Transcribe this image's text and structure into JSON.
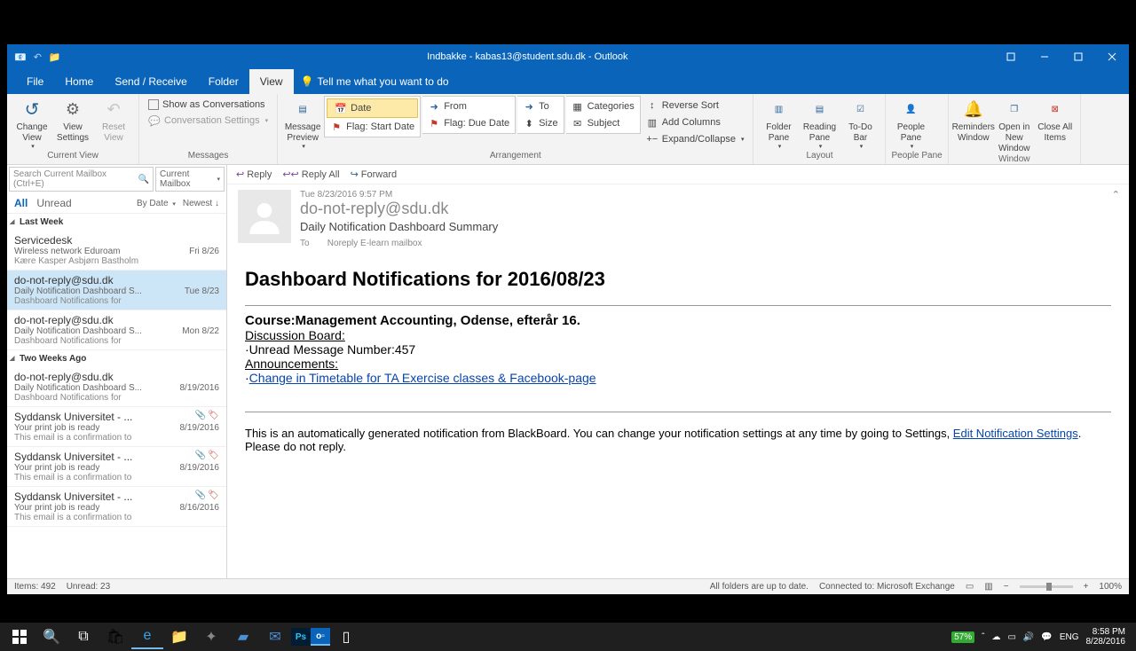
{
  "title": "Indbakke - kabas13@student.sdu.dk - Outlook",
  "menu": {
    "file": "File",
    "home": "Home",
    "sendreceive": "Send / Receive",
    "folder": "Folder",
    "view": "View",
    "tellme": "Tell me what you want to do"
  },
  "ribbon": {
    "changeview": "Change View",
    "viewsettings": "View Settings",
    "resetview": "Reset View",
    "currentview_label": "Current View",
    "showconv": "Show as Conversations",
    "convsettings": "Conversation Settings",
    "messages_label": "Messages",
    "msgpreview": "Message Preview",
    "arr_date": "Date",
    "arr_from": "From",
    "arr_to": "To",
    "arr_categories": "Categories",
    "arr_flagstart": "Flag: Start Date",
    "arr_flagdue": "Flag: Due Date",
    "arr_size": "Size",
    "arr_subject": "Subject",
    "reversesort": "Reverse Sort",
    "addcolumns": "Add Columns",
    "expandcollapse": "Expand/Collapse",
    "arrangement_label": "Arrangement",
    "folderpane": "Folder Pane",
    "readingpane": "Reading Pane",
    "todobar": "To-Do Bar",
    "layout_label": "Layout",
    "peoplepane": "People Pane",
    "peoplepane_label": "People Pane",
    "reminders": "Reminders Window",
    "openinnew": "Open in New Window",
    "closeall": "Close All Items",
    "window_label": "Window"
  },
  "search": {
    "placeholder": "Search Current Mailbox (Ctrl+E)",
    "scope": "Current Mailbox"
  },
  "filter": {
    "all": "All",
    "unread": "Unread",
    "bydate": "By Date",
    "newest": "Newest"
  },
  "groups": {
    "lastweek": "Last Week",
    "twoweeks": "Two Weeks Ago"
  },
  "mails": [
    {
      "from": "Servicedesk",
      "subj": "Wireless network Eduroam",
      "prev": "Kære Kasper Asbjørn Bastholm",
      "date": "Fri 8/26",
      "att": false,
      "flag": false
    },
    {
      "from": "do-not-reply@sdu.dk",
      "subj": "Daily Notification Dashboard S...",
      "prev": "Dashboard Notifications for",
      "date": "Tue 8/23",
      "att": false,
      "flag": false,
      "sel": true
    },
    {
      "from": "do-not-reply@sdu.dk",
      "subj": "Daily Notification Dashboard S...",
      "prev": "Dashboard Notifications for",
      "date": "Mon 8/22",
      "att": false,
      "flag": false
    },
    {
      "from": "do-not-reply@sdu.dk",
      "subj": "Daily Notification Dashboard S...",
      "prev": "Dashboard Notifications for",
      "date": "8/19/2016",
      "att": false,
      "flag": false
    },
    {
      "from": "Syddansk Universitet - ...",
      "subj": "Your print job is ready",
      "prev": "This email is a confirmation to",
      "date": "8/19/2016",
      "att": true,
      "flag": true
    },
    {
      "from": "Syddansk Universitet - ...",
      "subj": "Your print job is ready",
      "prev": "This email is a confirmation to",
      "date": "8/19/2016",
      "att": true,
      "flag": true
    },
    {
      "from": "Syddansk Universitet - ...",
      "subj": "Your print job is ready",
      "prev": "This email is a confirmation to",
      "date": "8/16/2016",
      "att": true,
      "flag": true
    }
  ],
  "reader": {
    "reply": "Reply",
    "replyall": "Reply All",
    "forward": "Forward",
    "date": "Tue 8/23/2016 9:57 PM",
    "from": "do-not-reply@sdu.dk",
    "subject": "Daily Notification Dashboard Summary",
    "to_label": "To",
    "to": "Noreply E-learn mailbox",
    "h1": "Dashboard Notifications for 2016/08/23",
    "course": "Course:Management Accounting, Odense, efterår 16.",
    "disc": "Discussion Board:",
    "unread": "·Unread Message Number:457",
    "ann": "Announcements:",
    "linkprefix": "·",
    "link": "Change in Timetable for TA Exercise classes & Facebook-page",
    "footer1": "This is an automatically generated notification from BlackBoard. You can change your notification settings at any time by going to Settings, ",
    "footerlink": "Edit Notification Settings",
    "footer2": ". Please do not reply."
  },
  "status": {
    "items": "Items: 492",
    "unread": "Unread: 23",
    "folders": "All folders are up to date.",
    "connected": "Connected to: Microsoft Exchange",
    "zoom": "100%"
  },
  "taskbar": {
    "time": "8:58 PM",
    "date": "8/28/2016",
    "lang": "ENG",
    "battery": "57%"
  }
}
